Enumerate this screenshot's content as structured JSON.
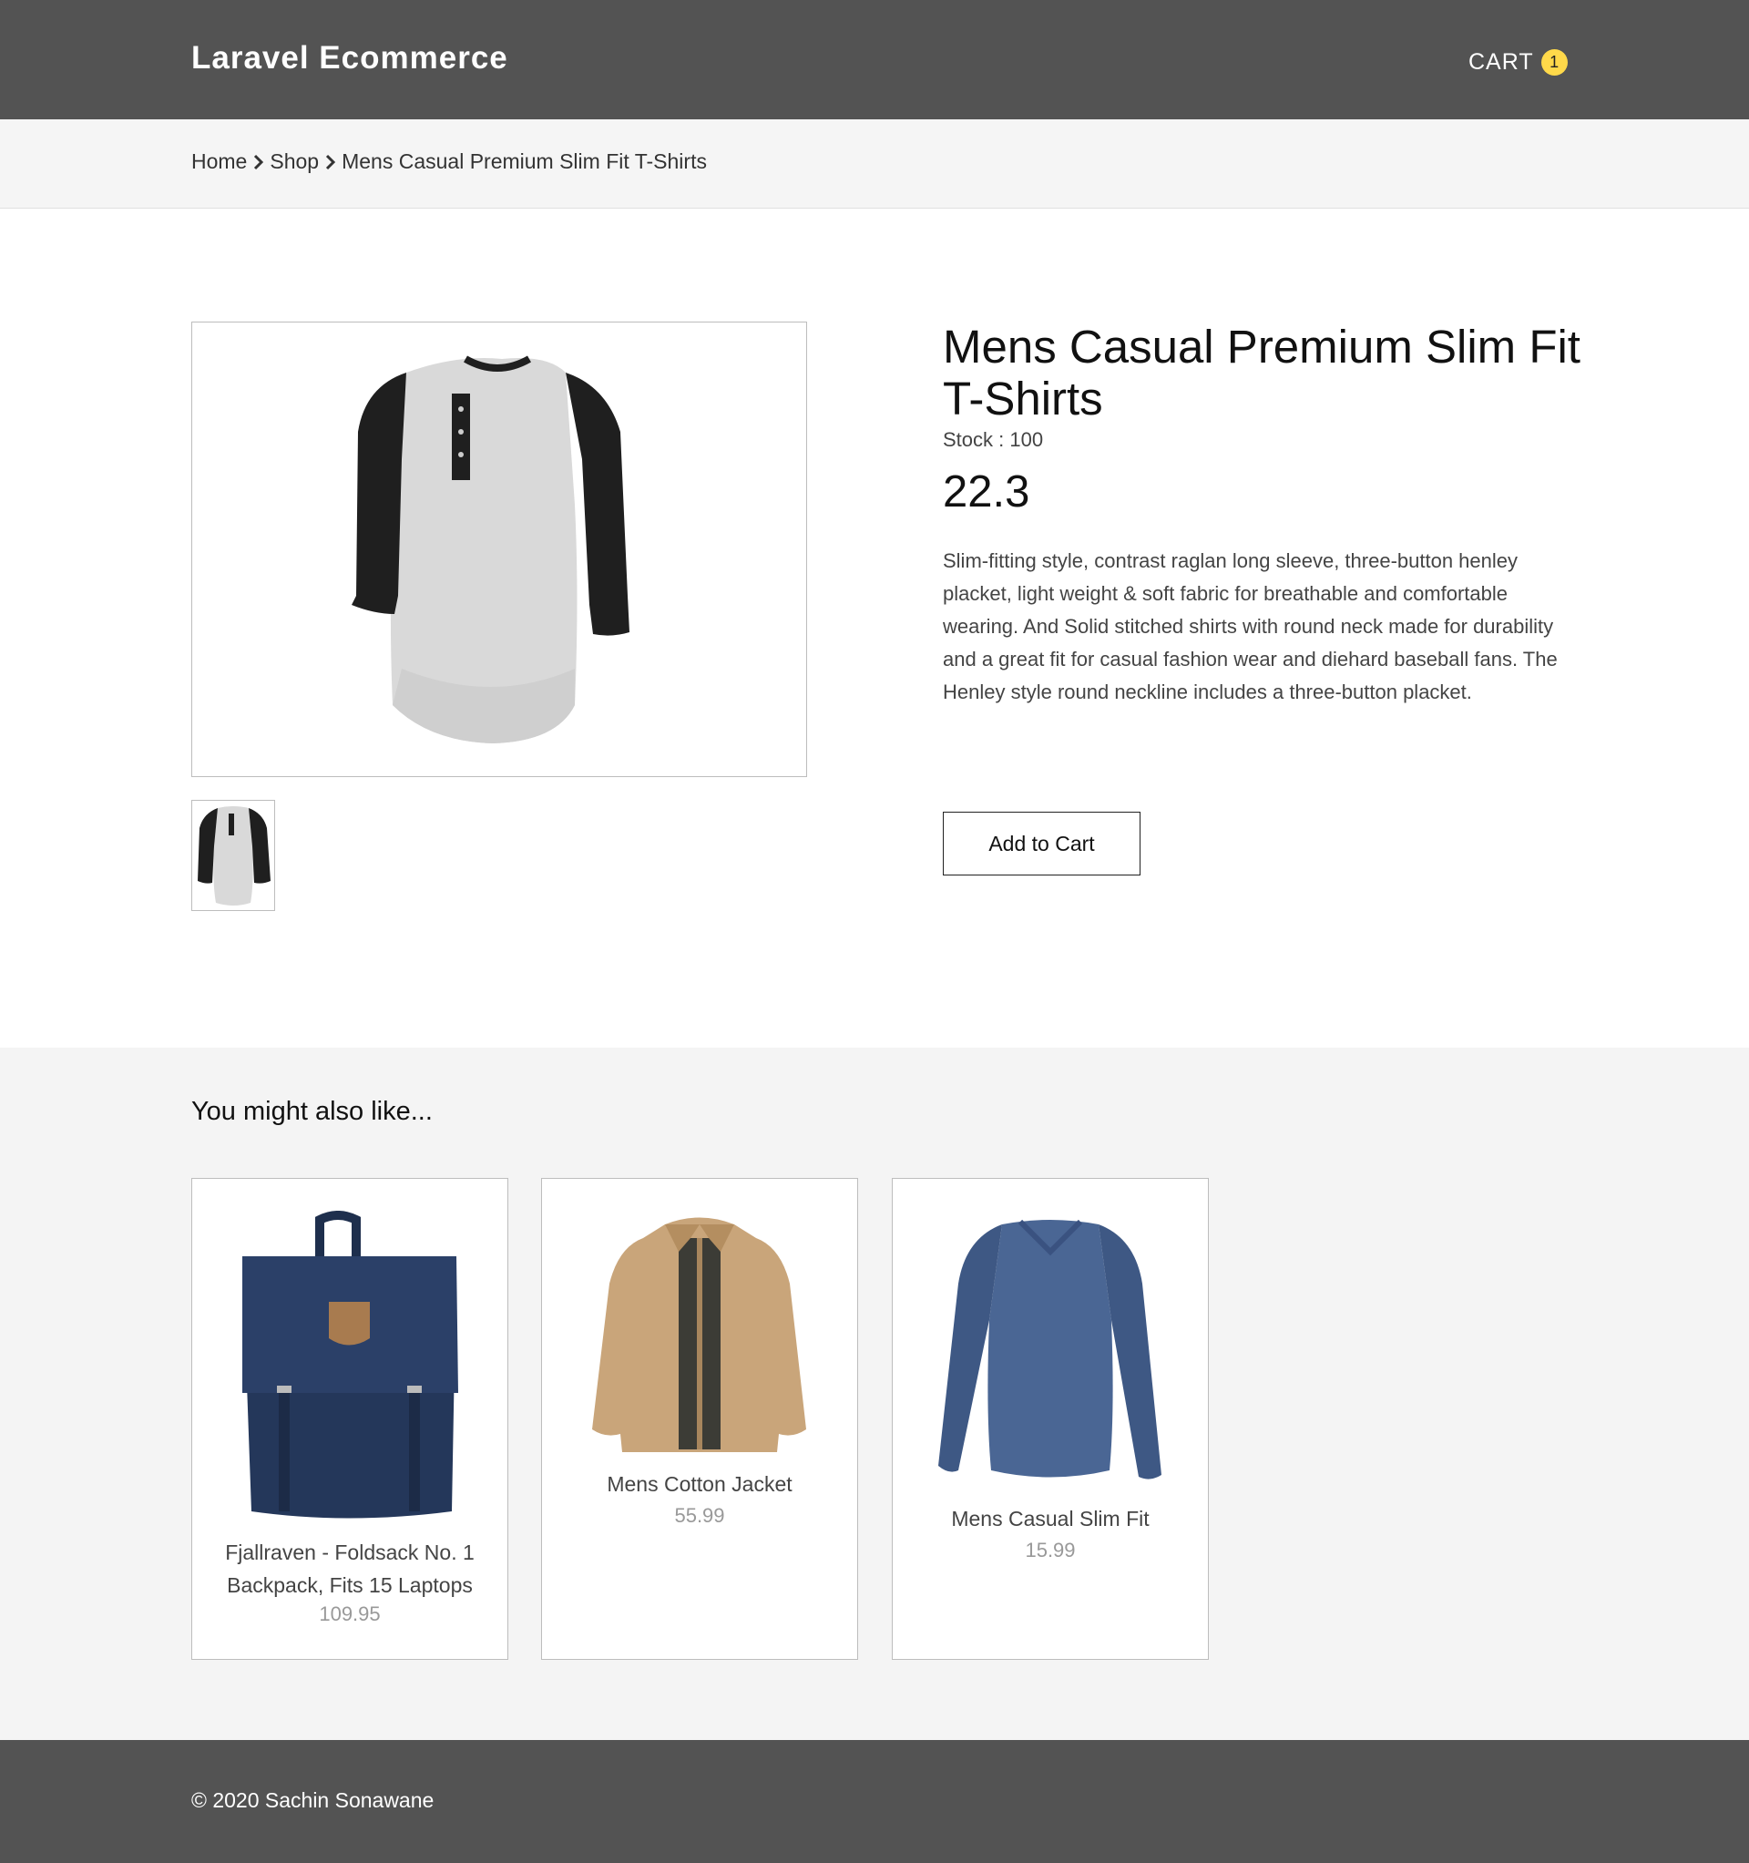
{
  "header": {
    "brand": "Laravel Ecommerce",
    "cart_label": "CART",
    "cart_count": "1",
    "cart_badge_color": "#ffd94a",
    "background": "#535353"
  },
  "breadcrumb": {
    "items": [
      "Home",
      "Shop"
    ],
    "current": "Mens Casual Premium Slim Fit T-Shirts"
  },
  "product": {
    "title": "Mens Casual Premium Slim Fit T-Shirts",
    "stock": "Stock : 100",
    "price": "22.3",
    "description": "Slim-fitting style, contrast raglan long sleeve, three-button henley placket, light weight & soft fabric for breathable and comfortable wearing. And Solid stitched shirts with round neck made for durability and a great fit for casual fashion wear and diehard baseball fans. The Henley style round neckline includes a three-button placket.",
    "add_to_cart_label": "Add to Cart",
    "image_icon": "raglan-henley-tshirt-image"
  },
  "related": {
    "title": "You might also like...",
    "items": [
      {
        "name": "Fjallraven - Foldsack No. 1 Backpack, Fits 15 Laptops",
        "price": "109.95",
        "image_icon": "navy-backpack-image"
      },
      {
        "name": "Mens Cotton Jacket",
        "price": "55.99",
        "image_icon": "tan-jacket-image"
      },
      {
        "name": "Mens Casual Slim Fit",
        "price": "15.99",
        "image_icon": "blue-longsleeve-image"
      }
    ]
  },
  "footer": {
    "text": "© 2020 Sachin Sonawane"
  }
}
